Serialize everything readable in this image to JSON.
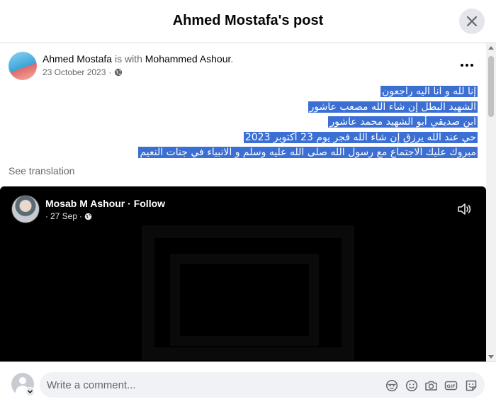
{
  "header": {
    "title": "Ahmed Mostafa's post",
    "close_icon": "close-icon"
  },
  "post": {
    "author": "Ahmed Mostafa",
    "with_text": "is with",
    "tagged": "Mohammed Ashour",
    "tagged_suffix": ".",
    "date": "23 October 2023",
    "date_separator": "·",
    "privacy_icon": "globe-icon",
    "more_icon": "more-options-icon",
    "text_lines": [
      "إنا لله و انا اليه راجعون",
      "الشهيد البطل إن شاء الله مصعب عاشور",
      "ابن صديقي أبو الشهيد محمد عاشور",
      "حي عند الله يرزق إن شاء الله  فجر يوم 23 أكتوبر 2023",
      "مبروك عليك الاجتماع مع رسول الله صلى الله عليه وسلم و الانبياء في جنات النعيم"
    ],
    "highlight_color": "#3b6fd3",
    "see_translation": "See translation"
  },
  "shared_video": {
    "title": "Mosab M Ashour · Follow",
    "meta_prefix": "·",
    "date": "27 Sep",
    "meta_separator": "·",
    "privacy_icon": "globe-icon",
    "sound_icon": "speaker-icon"
  },
  "comment": {
    "placeholder": "Write a comment...",
    "icons": [
      "avatar-sticker-icon",
      "emoji-icon",
      "camera-icon",
      "gif-icon",
      "sticker-icon"
    ]
  },
  "colors": {
    "accent": "#1877f2",
    "secondary_text": "#65676b",
    "surface": "#f0f2f5"
  }
}
